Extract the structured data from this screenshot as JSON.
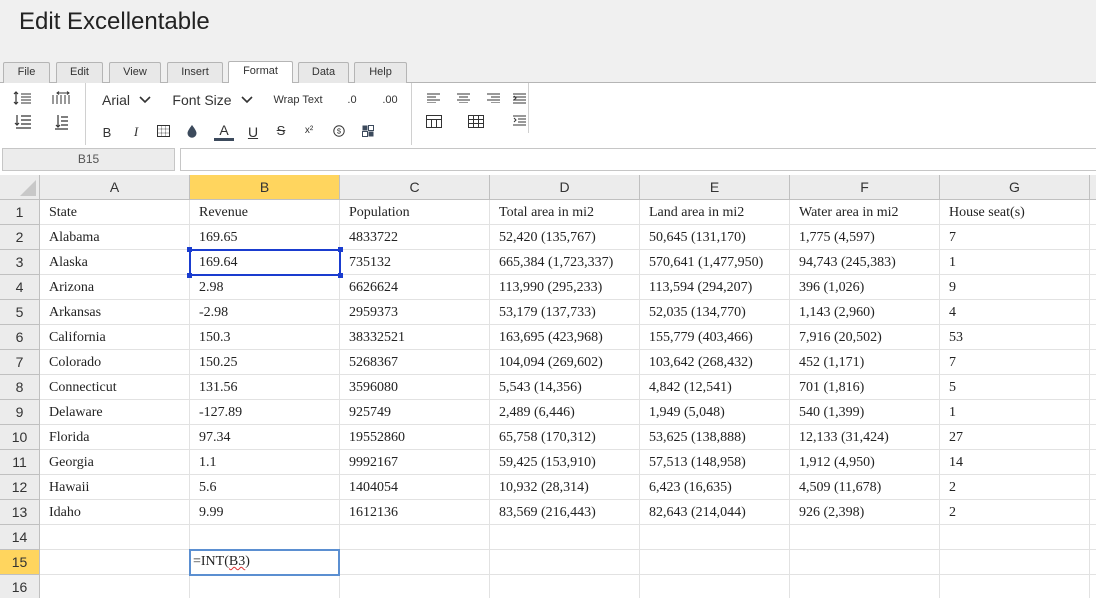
{
  "app": {
    "title": "Edit Excellentable"
  },
  "menu_tabs": [
    "File",
    "Edit",
    "View",
    "Insert",
    "Format",
    "Data",
    "Help"
  ],
  "active_tab": "Format",
  "toolbar": {
    "font_family": "Arial",
    "font_size": "Font Size",
    "wrap_text": "Wrap Text",
    "decrease_decimal": ".0",
    "increase_decimal": ".00",
    "bold": "B",
    "italic": "I",
    "strikethrough": "S",
    "underline": "U",
    "font_color": "A",
    "superscript": "x²"
  },
  "formula_bar": {
    "cell_ref": "B15",
    "value": ""
  },
  "columns": [
    "A",
    "B",
    "C",
    "D",
    "E",
    "F",
    "G"
  ],
  "selected_column": "B",
  "selected_row": "15",
  "rows": [
    {
      "num": "1",
      "cells": [
        "State",
        "Revenue",
        "Population",
        "Total area in mi2",
        "Land area in mi2",
        "Water area in mi2",
        "House seat(s)"
      ]
    },
    {
      "num": "2",
      "cells": [
        "Alabama",
        "169.65",
        "4833722",
        "52,420 (135,767)",
        "50,645 (131,170)",
        "1,775 (4,597)",
        "7"
      ]
    },
    {
      "num": "3",
      "cells": [
        "Alaska",
        "169.64",
        "735132",
        "665,384 (1,723,337)",
        "570,641 (1,477,950)",
        "94,743 (245,383)",
        "1"
      ]
    },
    {
      "num": "4",
      "cells": [
        "Arizona",
        "2.98",
        "6626624",
        "113,990 (295,233)",
        "113,594 (294,207)",
        "396 (1,026)",
        "9"
      ]
    },
    {
      "num": "5",
      "cells": [
        "Arkansas",
        "-2.98",
        "2959373",
        "53,179 (137,733)",
        "52,035 (134,770)",
        "1,143 (2,960)",
        "4"
      ]
    },
    {
      "num": "6",
      "cells": [
        "California",
        "150.3",
        "38332521",
        "163,695 (423,968)",
        "155,779 (403,466)",
        "7,916 (20,502)",
        "53"
      ]
    },
    {
      "num": "7",
      "cells": [
        "Colorado",
        "150.25",
        "5268367",
        "104,094 (269,602)",
        "103,642 (268,432)",
        "452 (1,171)",
        "7"
      ]
    },
    {
      "num": "8",
      "cells": [
        "Connecticut",
        "131.56",
        "3596080",
        "5,543 (14,356)",
        "4,842 (12,541)",
        "701 (1,816)",
        "5"
      ]
    },
    {
      "num": "9",
      "cells": [
        "Delaware",
        "-127.89",
        "925749",
        "2,489 (6,446)",
        "1,949 (5,048)",
        "540 (1,399)",
        "1"
      ]
    },
    {
      "num": "10",
      "cells": [
        "Florida",
        "97.34",
        "19552860",
        "65,758 (170,312)",
        "53,625 (138,888)",
        "12,133 (31,424)",
        "27"
      ]
    },
    {
      "num": "11",
      "cells": [
        "Georgia",
        "1.1",
        "9992167",
        "59,425 (153,910)",
        "57,513 (148,958)",
        "1,912 (4,950)",
        "14"
      ]
    },
    {
      "num": "12",
      "cells": [
        "Hawaii",
        "5.6",
        "1404054",
        "10,932 (28,314)",
        "6,423 (16,635)",
        "4,509 (11,678)",
        "2"
      ]
    },
    {
      "num": "13",
      "cells": [
        "Idaho",
        "9.99",
        "1612136",
        "83,569 (216,443)",
        "82,643 (214,044)",
        "926 (2,398)",
        "2"
      ]
    },
    {
      "num": "14",
      "cells": [
        "",
        "",
        "",
        "",
        "",
        "",
        ""
      ]
    },
    {
      "num": "15",
      "cells": [
        "",
        "",
        "",
        "",
        "",
        "",
        ""
      ]
    },
    {
      "num": "16",
      "cells": [
        "",
        "",
        "",
        "",
        "",
        "",
        ""
      ]
    }
  ],
  "editing_cell": {
    "prefix": "=INT(",
    "ref": "B3",
    "suffix": ")"
  },
  "colors": {
    "selection": "#1a3ccf",
    "header_highlight": "#ffd55e",
    "edit_border": "#5b8fd1"
  }
}
